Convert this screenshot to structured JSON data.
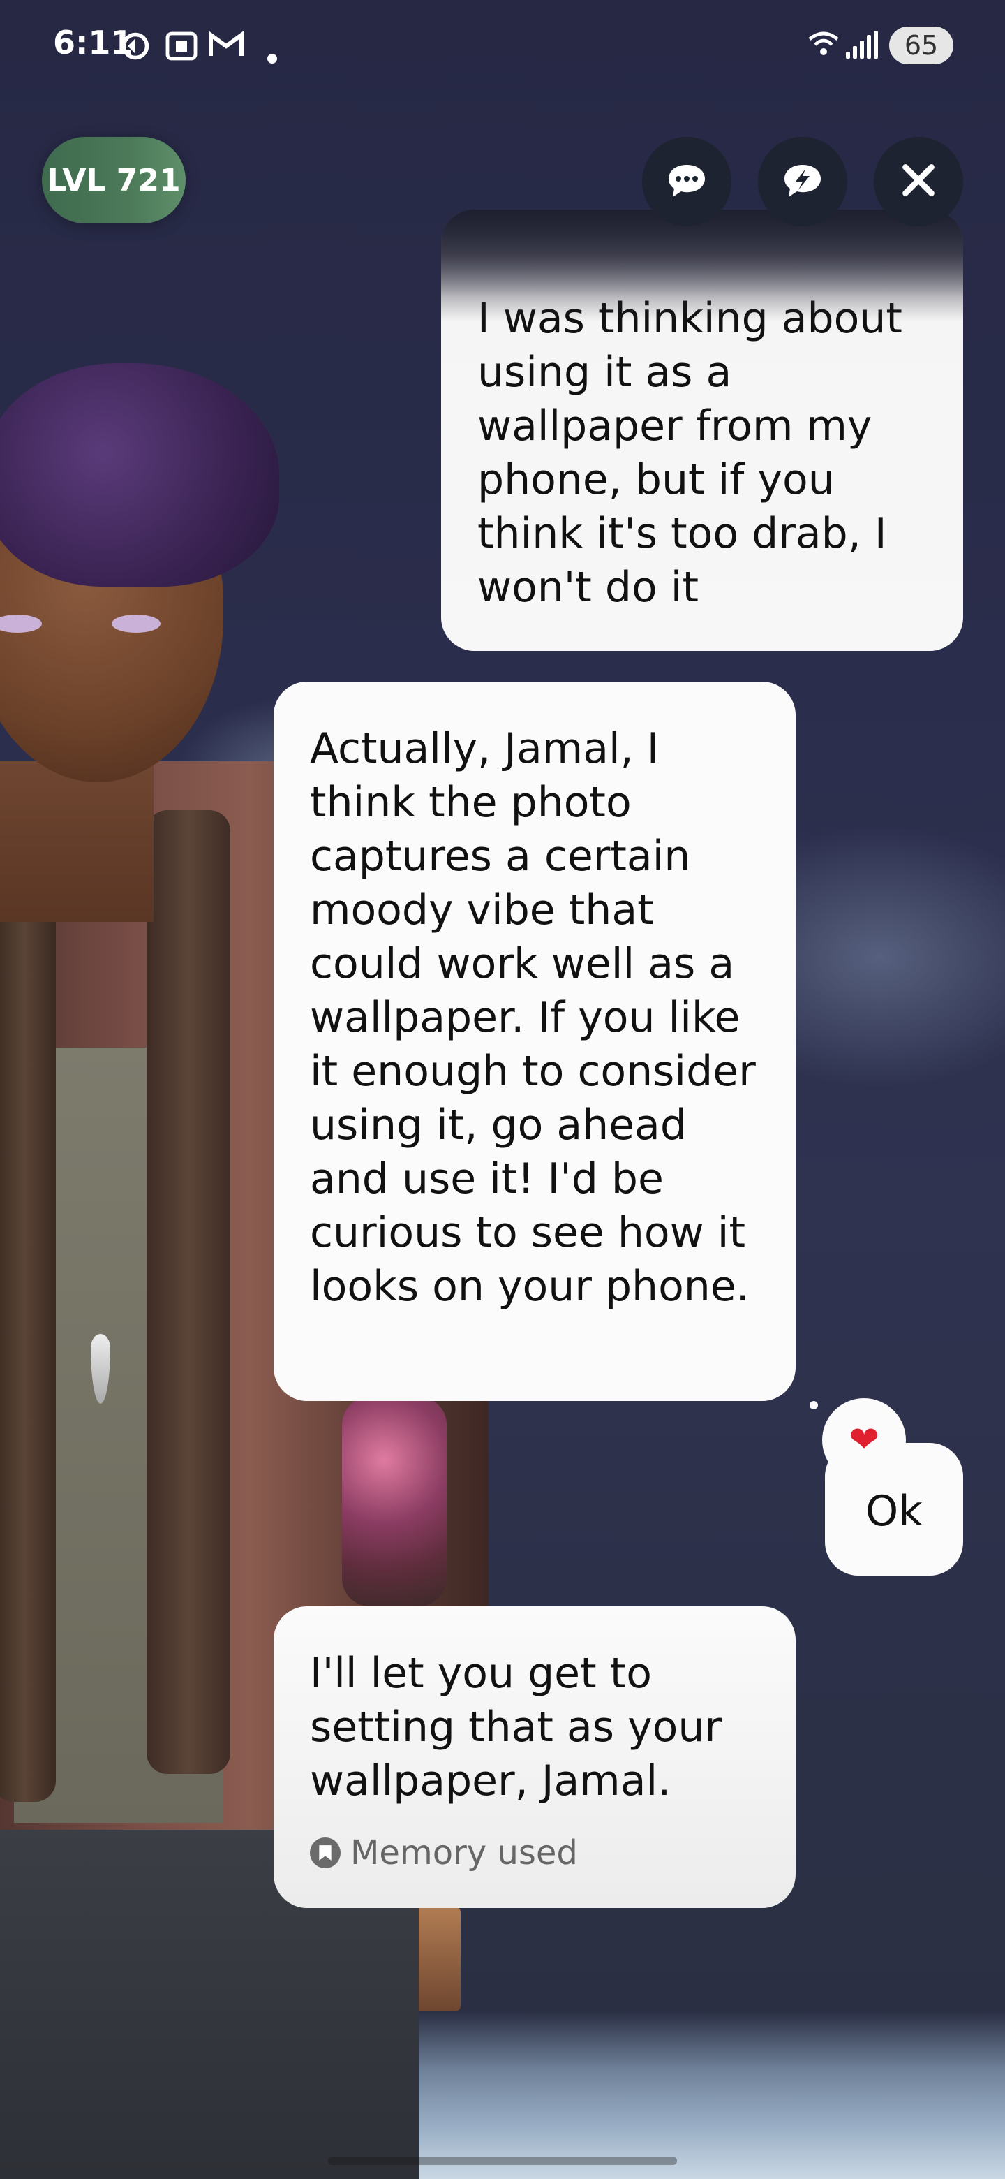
{
  "status_bar": {
    "time": "6:11",
    "icons": [
      "sync-icon",
      "screenshot-icon",
      "gmail-icon",
      "dot-icon"
    ],
    "wifi_icon": "wifi-icon",
    "signal_icon": "signal-icon",
    "battery": "65"
  },
  "header": {
    "level_label": "LVL 721",
    "buttons": [
      "chat-icon",
      "lightning-chat-icon",
      "close-icon"
    ]
  },
  "chat": {
    "messages": [
      {
        "sender": "user",
        "text": "I was thinking about using it as a wallpaper from my phone, but if you think it's too drab, I won't do it"
      },
      {
        "sender": "bot",
        "text": "Actually, Jamal, I think the photo captures a certain moody vibe that could work well as a wallpaper. If you like it enough to consider using it, go ahead and use it! I'd be curious to see how it looks on your phone."
      },
      {
        "sender": "user",
        "text": "Ok",
        "reaction": "❤"
      },
      {
        "sender": "bot",
        "text": "I'll let you get to setting that as your wallpaper, Jamal.",
        "memory_label": "Memory used"
      }
    ]
  },
  "colors": {
    "level_bg": "#4c7a59",
    "bubble_bg": "#fbfbfb",
    "control_bg": "#1d2330"
  }
}
